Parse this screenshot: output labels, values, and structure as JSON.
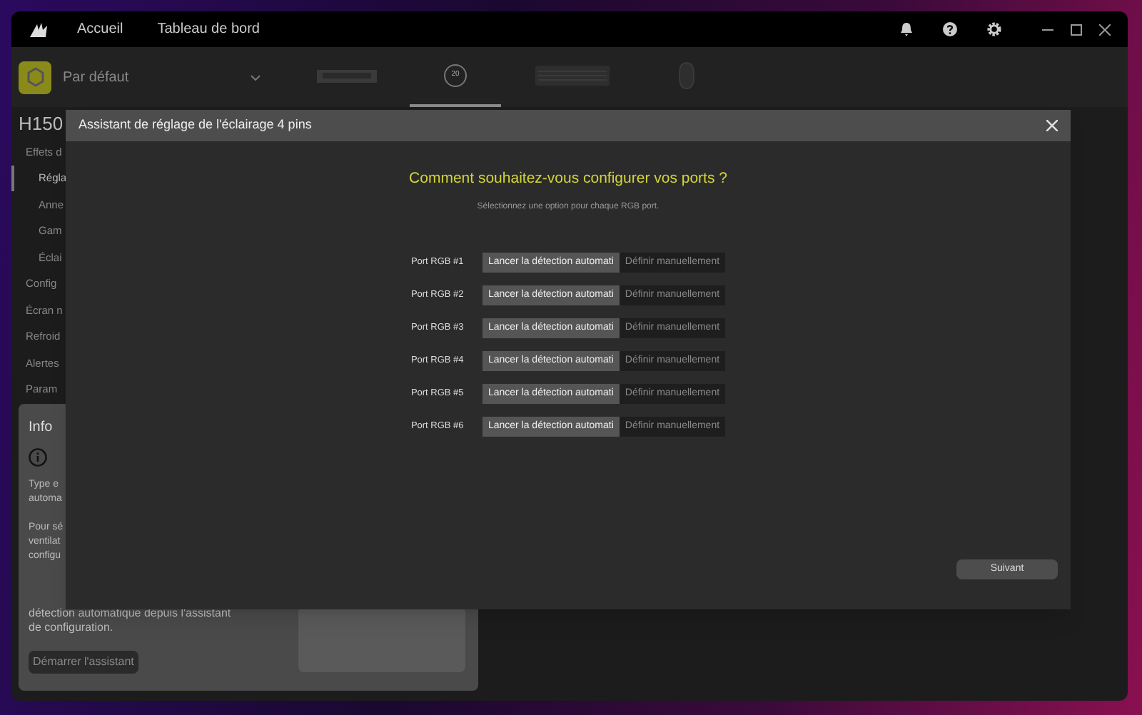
{
  "nav": [
    {
      "label": "Accueil"
    },
    {
      "label": "Tableau de bord"
    }
  ],
  "profile": {
    "name": "Par défaut"
  },
  "devices": [
    {
      "kind": "ram",
      "selected": false
    },
    {
      "kind": "cooler",
      "label": "20",
      "selected": true
    },
    {
      "kind": "keyboard",
      "selected": false
    },
    {
      "kind": "mouse",
      "selected": false
    }
  ],
  "sidebar": {
    "title": "H150",
    "items": [
      {
        "label": "Effets d",
        "selected": false,
        "children": [
          {
            "label": "Régla",
            "selected": true
          },
          {
            "label": "Anne",
            "selected": false
          },
          {
            "label": "Gam",
            "selected": false
          },
          {
            "label": "Éclai",
            "selected": false
          }
        ]
      },
      {
        "label": "Config",
        "selected": false
      },
      {
        "label": "Écran n",
        "selected": false
      },
      {
        "label": "Refroid",
        "selected": false
      },
      {
        "label": "Alertes",
        "selected": false
      },
      {
        "label": "Param",
        "selected": false
      }
    ]
  },
  "info": {
    "title": "Info",
    "fragments": [
      "Type e",
      "automa",
      "Pour sé",
      "ventilat",
      "configu"
    ],
    "tail": [
      "détection automatique depuis l'assistant",
      "de configuration."
    ],
    "button": "Démarrer l'assistant"
  },
  "dialog": {
    "title": "Assistant de réglage de l'éclairage 4 pins",
    "heading": "Comment souhaitez-vous configurer vos ports ?",
    "subtitle": "Sélectionnez une option pour chaque RGB port.",
    "ports": [
      {
        "label": "Port RGB #1",
        "options": [
          {
            "label": "Lancer la détection automati",
            "selected": true
          },
          {
            "label": "Définir manuellement",
            "selected": false
          }
        ]
      },
      {
        "label": "Port RGB #2",
        "options": [
          {
            "label": "Lancer la détection automati",
            "selected": true
          },
          {
            "label": "Définir manuellement",
            "selected": false
          }
        ]
      },
      {
        "label": "Port RGB #3",
        "options": [
          {
            "label": "Lancer la détection automati",
            "selected": true
          },
          {
            "label": "Définir manuellement",
            "selected": false
          }
        ]
      },
      {
        "label": "Port RGB #4",
        "options": [
          {
            "label": "Lancer la détection automati",
            "selected": true
          },
          {
            "label": "Définir manuellement",
            "selected": false
          }
        ]
      },
      {
        "label": "Port RGB #5",
        "options": [
          {
            "label": "Lancer la détection automati",
            "selected": true
          },
          {
            "label": "Définir manuellement",
            "selected": false
          }
        ]
      },
      {
        "label": "Port RGB #6",
        "options": [
          {
            "label": "Lancer la détection automati",
            "selected": true
          },
          {
            "label": "Définir manuellement",
            "selected": false
          }
        ]
      }
    ],
    "next_button": "Suivant"
  }
}
